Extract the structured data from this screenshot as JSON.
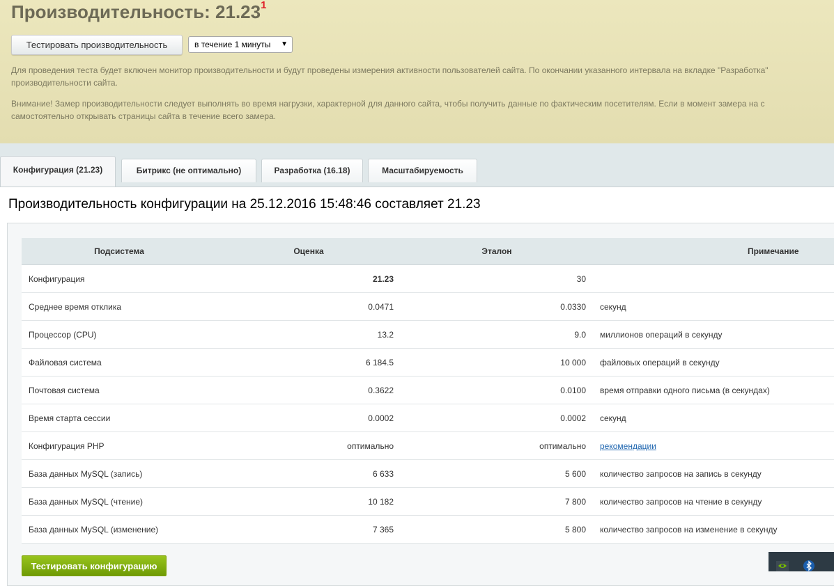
{
  "header": {
    "title": "Производительность: 21.23",
    "title_sup": "1",
    "test_button": "Тестировать производительность",
    "duration_select": "в течение 1 минуты",
    "info_line1": "Для проведения теста будет включен монитор производительности и будут проведены измерения активности пользователей сайта. По окончании указанного интервала на вкладке \"Разработка\"",
    "info_line2": "производительности сайта.",
    "warning_line1": "Внимание! Замер производительности следует выполнять во время нагрузки, характерной для данного сайта, чтобы получить данные по фактическим посетителям. Если в момент замера на с",
    "warning_line2": "самостоятельно открывать страницы сайта в течение всего замера."
  },
  "tabs": [
    {
      "label": "Конфигурация (21.23)",
      "active": true
    },
    {
      "label": "Битрикс (не оптимально)",
      "active": false
    },
    {
      "label": "Разработка (16.18)",
      "active": false
    },
    {
      "label": "Масштабируемость",
      "active": false
    }
  ],
  "section_title": "Производительность конфигурации на 25.12.2016 15:48:46 составляет 21.23",
  "table": {
    "headers": {
      "subsystem": "Подсистема",
      "score": "Оценка",
      "reference": "Эталон",
      "note": "Примечание"
    },
    "rows": [
      {
        "subsystem": "Конфигурация",
        "score": "21.23",
        "reference": "30",
        "note": ""
      },
      {
        "subsystem": "Среднее время отклика",
        "score": "0.0471",
        "reference": "0.0330",
        "note": "секунд"
      },
      {
        "subsystem": "Процессор (CPU)",
        "score": "13.2",
        "reference": "9.0",
        "note": "миллионов операций в секунду"
      },
      {
        "subsystem": "Файловая система",
        "score": "6 184.5",
        "reference": "10 000",
        "note": "файловых операций в секунду"
      },
      {
        "subsystem": "Почтовая система",
        "score": "0.3622",
        "reference": "0.0100",
        "note": "время отправки одного письма (в секундах)"
      },
      {
        "subsystem": "Время старта сессии",
        "score": "0.0002",
        "reference": "0.0002",
        "note": "секунд"
      },
      {
        "subsystem": "Конфигурация PHP",
        "score": "оптимально",
        "reference": "оптимально",
        "note": "рекомендации"
      },
      {
        "subsystem": "База данных MySQL (запись)",
        "score": "6 633",
        "reference": "5 600",
        "note": "количество запросов на запись в секунду"
      },
      {
        "subsystem": "База данных MySQL (чтение)",
        "score": "10 182",
        "reference": "7 800",
        "note": "количество запросов на чтение в секунду"
      },
      {
        "subsystem": "База данных MySQL (изменение)",
        "score": "7 365",
        "reference": "5 800",
        "note": "количество запросов на изменение в секунду"
      }
    ]
  },
  "footer": {
    "test_config_button": "Тестировать конфигурацию"
  },
  "colors": {
    "header_bg": "#e6e0b4",
    "tabs_bg": "#e0e8ea",
    "link": "#2067b0",
    "green_button": "#84b014",
    "title_sup": "#e0202a"
  },
  "tray_icons": [
    "nvidia-icon",
    "bluetooth-icon"
  ]
}
